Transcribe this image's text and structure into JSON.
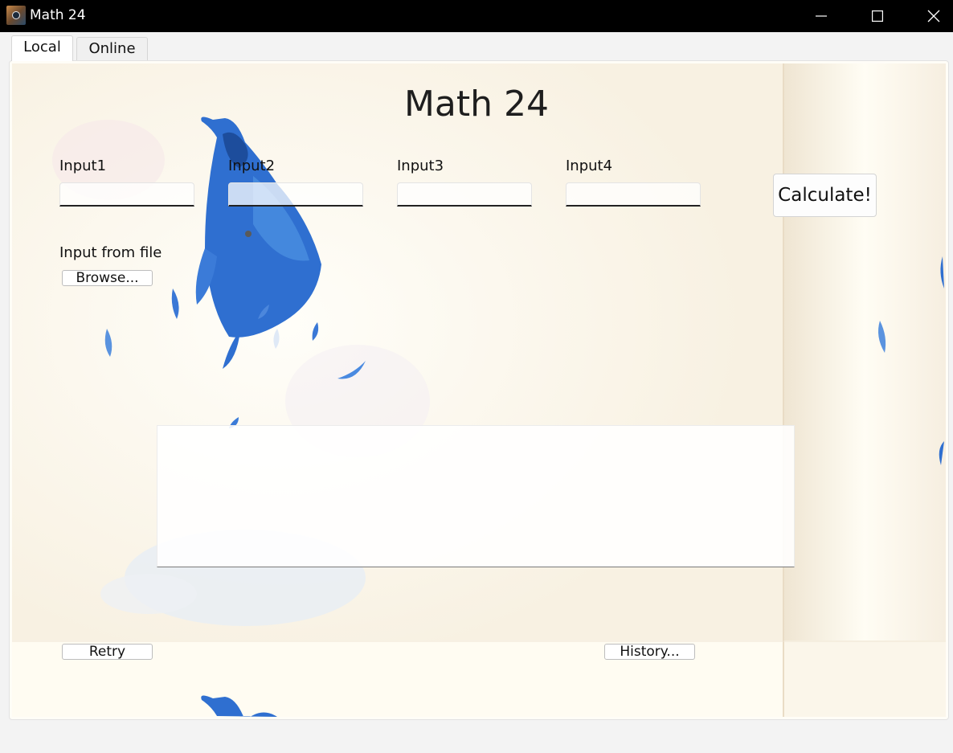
{
  "window": {
    "title": "Math 24"
  },
  "tabs": [
    {
      "label": "Local",
      "selected": true
    },
    {
      "label": "Online",
      "selected": false
    }
  ],
  "main": {
    "heading": "Math 24",
    "inputs": [
      {
        "label": "Input1",
        "value": ""
      },
      {
        "label": "Input2",
        "value": ""
      },
      {
        "label": "Input3",
        "value": ""
      },
      {
        "label": "Input4",
        "value": ""
      }
    ],
    "calculate_label": "Calculate!",
    "file_label": "Input from file",
    "browse_label": "Browse...",
    "result_text": "",
    "retry_label": "Retry",
    "history_label": "History..."
  },
  "icons": {
    "app": "app-icon",
    "minimize": "minimize-icon",
    "maximize": "maximize-icon",
    "close": "close-icon",
    "background": "bluebird-painting"
  },
  "colors": {
    "titlebar": "#000000",
    "panel_background": "#fffdf7",
    "bird_blue": "#2f6fd0"
  }
}
